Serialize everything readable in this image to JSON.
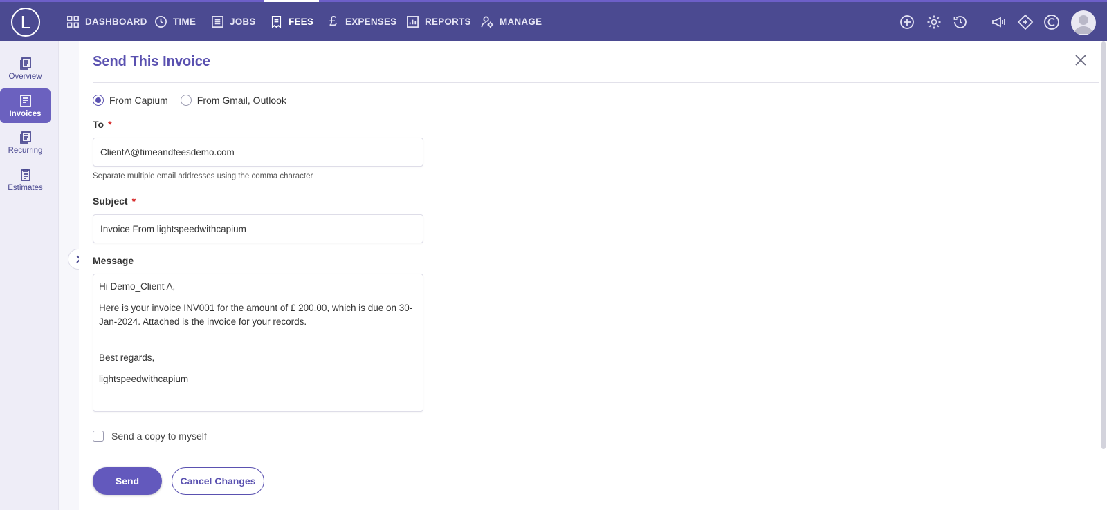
{
  "app": {
    "logo_letter": "L"
  },
  "nav": {
    "items": [
      {
        "label": "DASHBOARD",
        "icon": "grid-icon"
      },
      {
        "label": "TIME",
        "icon": "clock-icon"
      },
      {
        "label": "JOBS",
        "icon": "list-icon"
      },
      {
        "label": "FEES",
        "icon": "receipt-icon",
        "active": true
      },
      {
        "label": "EXPENSES",
        "icon": "pound-icon",
        "glyph": "£"
      },
      {
        "label": "REPORTS",
        "icon": "bar-chart-icon"
      },
      {
        "label": "MANAGE",
        "icon": "users-gear-icon"
      }
    ],
    "tools": [
      "plus-circle-icon",
      "gear-icon",
      "history-icon",
      "megaphone-icon",
      "diamond-icon",
      "capium-c-icon",
      "user-avatar-icon"
    ]
  },
  "sidebar": {
    "items": [
      {
        "label": "Overview",
        "icon": "document-icon"
      },
      {
        "label": "Invoices",
        "icon": "invoice-icon",
        "active": true
      },
      {
        "label": "Recurring",
        "icon": "document-icon"
      },
      {
        "label": "Estimates",
        "icon": "clipboard-icon"
      }
    ]
  },
  "form": {
    "title": "Send This Invoice",
    "send_via": {
      "options": [
        "From Capium",
        "From Gmail, Outlook"
      ],
      "selected": "From Capium"
    },
    "to": {
      "label": "To",
      "required_mark": "*",
      "value": "ClientA@timeandfeesdemo.com",
      "hint": "Separate multiple email addresses using the comma character"
    },
    "subject": {
      "label": "Subject",
      "required_mark": "*",
      "value": "Invoice From lightspeedwithcapium"
    },
    "message": {
      "label": "Message",
      "lines": [
        "Hi Demo_Client A,",
        "Here is your invoice INV001 for the amount of £ 200.00, which is due on 30-Jan-2024. Attached is the invoice for your records.",
        "",
        "Best regards,",
        "lightspeedwithcapium"
      ]
    },
    "send_copy_label": "Send a copy to myself",
    "send_copy_checked": false,
    "send_label": "Send",
    "cancel_label": "Cancel Changes"
  },
  "colors": {
    "nav_bg": "#4b4a91",
    "accent": "#6359bd",
    "title": "#5a51b0",
    "required": "#d62828"
  }
}
